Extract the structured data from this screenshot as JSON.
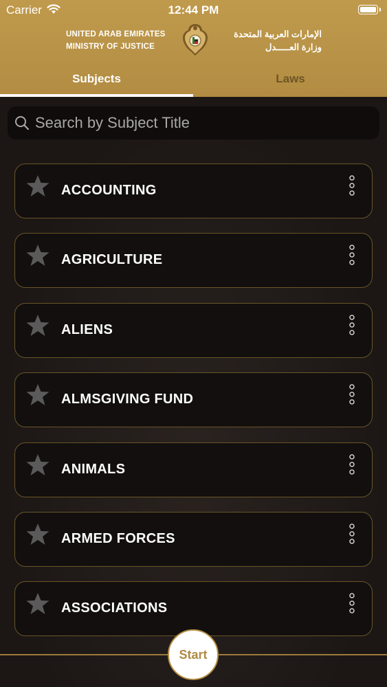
{
  "status_bar": {
    "carrier": "Carrier",
    "time": "12:44 PM"
  },
  "header": {
    "ministry_en_line1": "UNITED ARAB EMIRATES",
    "ministry_en_line2": "MINISTRY OF JUSTICE",
    "ministry_ar_line1": "الإمارات العربية المتحدة",
    "ministry_ar_line2": "وزارة العـــــدل",
    "tabs": [
      {
        "label": "Subjects",
        "active": true
      },
      {
        "label": "Laws",
        "active": false
      }
    ]
  },
  "search": {
    "placeholder": "Search by Subject Title",
    "value": ""
  },
  "subjects": [
    {
      "title": "ACCOUNTING"
    },
    {
      "title": "AGRICULTURE"
    },
    {
      "title": "ALIENS"
    },
    {
      "title": "ALMSGIVING FUND"
    },
    {
      "title": "ANIMALS"
    },
    {
      "title": "ARMED FORCES"
    },
    {
      "title": "ASSOCIATIONS"
    }
  ],
  "start_button": {
    "label": "Start"
  },
  "colors": {
    "header_gold": "#b8924a",
    "card_border": "#6a5528",
    "background": "#1e1916",
    "star": "#5a5a5a"
  },
  "icons": {
    "search": "search-icon",
    "favorite": "star-icon",
    "more": "more-vertical-icon",
    "emblem": "uae-emblem-icon"
  }
}
